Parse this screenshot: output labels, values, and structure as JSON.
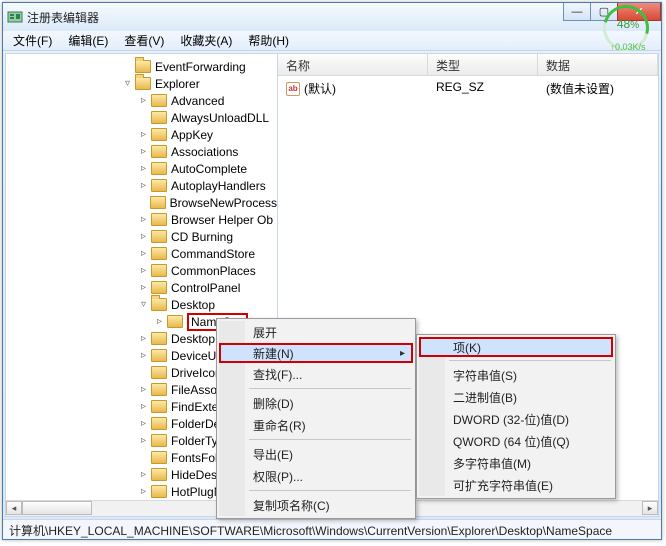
{
  "window": {
    "title": "注册表编辑器"
  },
  "menubar": {
    "file": "文件(F)",
    "edit": "编辑(E)",
    "view": "查看(V)",
    "fav": "收藏夹(A)",
    "help": "帮助(H)"
  },
  "speed": {
    "percent": "48",
    "pct_sign": "%",
    "rate": "↑0.03K/s"
  },
  "list": {
    "headers": {
      "name": "名称",
      "type": "类型",
      "data": "数据"
    },
    "rows": [
      {
        "name": "(默认)",
        "type": "REG_SZ",
        "data": "(数值未设置)"
      }
    ]
  },
  "tree": {
    "top": [
      {
        "depth": 0,
        "exp": "",
        "open": true,
        "label": "EventForwarding"
      },
      {
        "depth": 0,
        "exp": "▿",
        "open": true,
        "label": "Explorer"
      }
    ],
    "children": [
      {
        "exp": "▹",
        "label": "Advanced"
      },
      {
        "exp": "",
        "label": "AlwaysUnloadDLL"
      },
      {
        "exp": "▹",
        "label": "AppKey"
      },
      {
        "exp": "▹",
        "label": "Associations"
      },
      {
        "exp": "▹",
        "label": "AutoComplete"
      },
      {
        "exp": "▹",
        "label": "AutoplayHandlers"
      },
      {
        "exp": "",
        "label": "BrowseNewProcess"
      },
      {
        "exp": "▹",
        "label": "Browser Helper Ob"
      },
      {
        "exp": "▹",
        "label": "CD Burning"
      },
      {
        "exp": "▹",
        "label": "CommandStore"
      },
      {
        "exp": "▹",
        "label": "CommonPlaces"
      },
      {
        "exp": "▹",
        "label": "ControlPanel"
      },
      {
        "exp": "▿",
        "label": "Desktop",
        "open": true
      }
    ],
    "selected": {
      "exp": "▹",
      "label": "NameSpa"
    },
    "after": [
      {
        "exp": "▹",
        "label": "DesktopIniPr"
      },
      {
        "exp": "▹",
        "label": "DeviceUpdat"
      },
      {
        "exp": "",
        "label": "DriveIcons"
      },
      {
        "exp": "▹",
        "label": "FileAssociatio"
      },
      {
        "exp": "▹",
        "label": "FindExtension"
      },
      {
        "exp": "▹",
        "label": "FolderDescri"
      },
      {
        "exp": "▹",
        "label": "FolderTypes"
      },
      {
        "exp": "",
        "label": "FontsFolder"
      },
      {
        "exp": "▹",
        "label": "HideDesktop"
      },
      {
        "exp": "▹",
        "label": "HotPlugNotification"
      }
    ]
  },
  "ctx1": {
    "expand": "展开",
    "new": "新建(N)",
    "find": "查找(F)...",
    "delete": "删除(D)",
    "rename": "重命名(R)",
    "export": "导出(E)",
    "perm": "权限(P)...",
    "copyname": "复制项名称(C)"
  },
  "ctx2": {
    "key": "项(K)",
    "string": "字符串值(S)",
    "binary": "二进制值(B)",
    "dword": "DWORD (32-位)值(D)",
    "qword": "QWORD (64 位)值(Q)",
    "multi": "多字符串值(M)",
    "expand": "可扩充字符串值(E)"
  },
  "status": "计算机\\HKEY_LOCAL_MACHINE\\SOFTWARE\\Microsoft\\Windows\\CurrentVersion\\Explorer\\Desktop\\NameSpace",
  "glyph": {
    "tri_r": "▸",
    "tri_l": "◂",
    "min": "—",
    "max": "▢",
    "close": "✕",
    "submenu": "▸"
  }
}
